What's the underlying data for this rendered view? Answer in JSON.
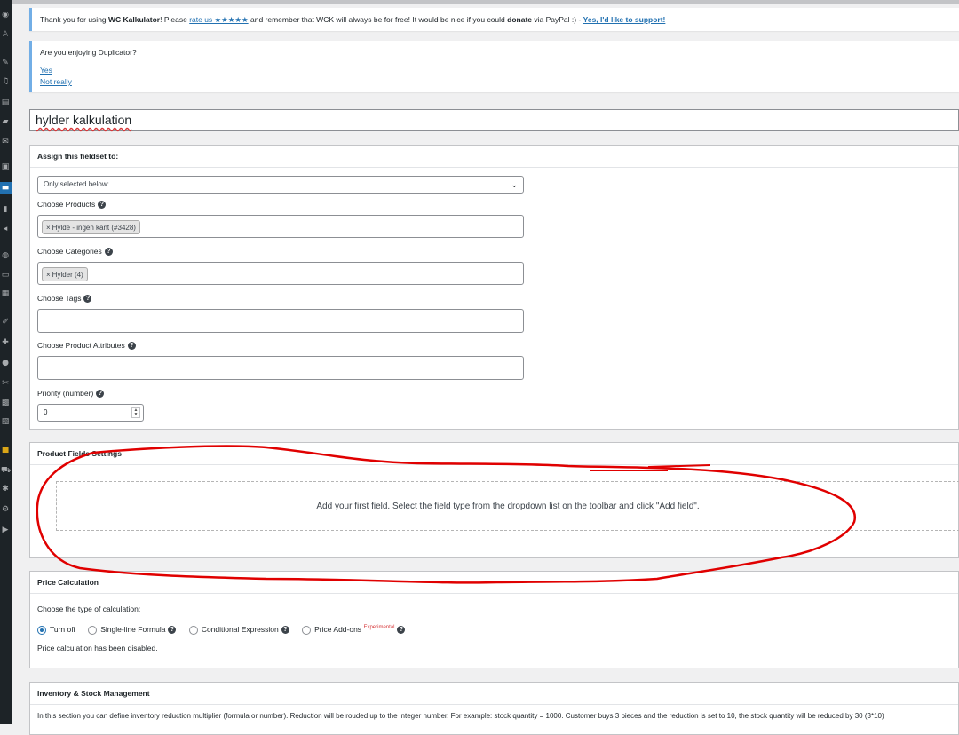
{
  "sidebar": {
    "icons": [
      "dashboard-icon",
      "astra-icon",
      "pin-icon",
      "media-icon",
      "pages-icon",
      "comments-icon",
      "mail-icon",
      "woocommerce-icon",
      "products-icon",
      "analytics-icon",
      "marketing-icon",
      "elementor-icon",
      "templates-icon",
      "screen-icon",
      "appearance-icon",
      "plugins-icon",
      "users-icon",
      "tools-icon",
      "settings-icon",
      "code-icon",
      "folder-icon",
      "cart-icon",
      "extensions-icon",
      "settings-gear-icon",
      "play-icon"
    ]
  },
  "notice_wck": {
    "t1": "Thank you for using ",
    "brand": "WC Kalkulator",
    "t2": "! Please ",
    "rate_link": "rate us ★★★★★",
    "t3": " and remember that WCK will always be for free! It would be nice if you could ",
    "donate": "donate",
    "t4": " via PayPal :) - ",
    "support_link": "Yes, I'd like to support!"
  },
  "notice_duplicator": {
    "question": "Are you enjoying Duplicator?",
    "yes": "Yes",
    "no": "Not really"
  },
  "title": {
    "value": "hylder kalkulation"
  },
  "assign": {
    "heading": "Assign this fieldset to:",
    "select_value": "Only selected below:",
    "products_label": "Choose Products",
    "products_tag": "Hylde - ingen kant (#3428)",
    "categories_label": "Choose Categories",
    "categories_tag": "Hylder (4)",
    "tags_label": "Choose Tags",
    "attributes_label": "Choose Product Attributes",
    "priority_label": "Priority (number)",
    "priority_value": "0"
  },
  "product_fields": {
    "heading": "Product Fields Settings",
    "empty_message": "Add your first field. Select the field type from the dropdown list on the toolbar and click \"Add field\"."
  },
  "price": {
    "heading": "Price Calculation",
    "choose_label": "Choose the type of calculation:",
    "options": [
      "Turn off",
      "Single-line Formula",
      "Conditional Expression",
      "Price Add-ons"
    ],
    "experimental": "Experimental",
    "status": "Price calculation has been disabled."
  },
  "inventory": {
    "heading": "Inventory & Stock Management",
    "description": "In this section you can define inventory reduction multiplier (formula or number). Reduction will be rouded up to the integer number. For example: stock quantity = 1000. Customer buys 3 pieces and the reduction is set to 10, the stock quantity will be reduced by 30 (3*10)"
  },
  "colors": {
    "accent": "#2271b1",
    "annotation": "#e00000",
    "sidebar": "#1d2327"
  }
}
